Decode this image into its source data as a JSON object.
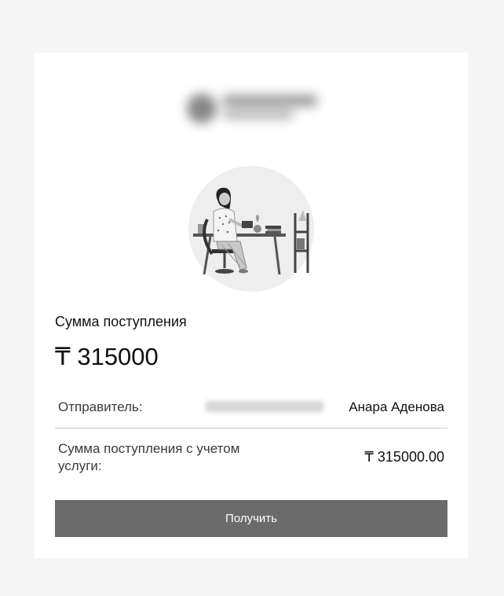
{
  "receipt": {
    "amount_label": "Сумма поступления",
    "amount_value": "₸ 315000",
    "sender_label": "Отправитель:",
    "sender_name": "Анара Аденова",
    "amount_with_fee_label": "Сумма поступления с учетом услуги:",
    "amount_with_fee_value": "₸ 315000.00",
    "receive_button_label": "Получить"
  },
  "colors": {
    "page_background": "#f5f5f5",
    "card_background": "#ffffff",
    "button_background": "#6b6b6b",
    "button_text": "#ffffff"
  },
  "icons": {
    "logo": "blurred-brand-logo",
    "illustration": "woman-reading-at-desk-illustration"
  }
}
